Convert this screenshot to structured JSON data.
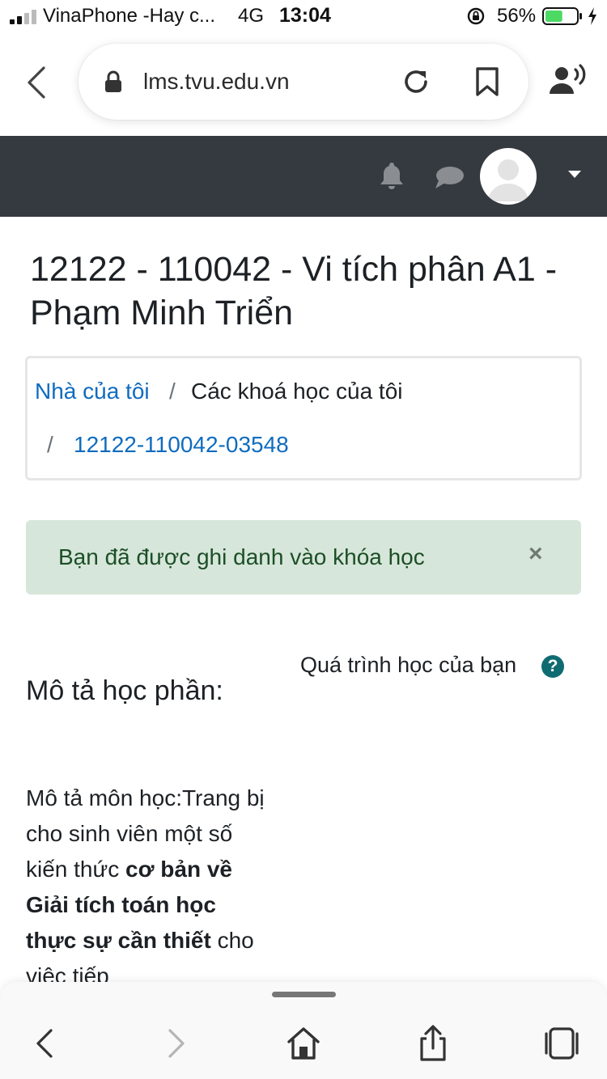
{
  "status_bar": {
    "carrier": "VinaPhone -Hay c...",
    "network": "4G",
    "time": "13:04",
    "battery_percent": "56%",
    "battery_level": 0.56
  },
  "browser": {
    "url": "lms.tvu.edu.vn"
  },
  "page": {
    "title": "12122 - 110042 - Vi tích phân A1 - Phạm Minh Triển"
  },
  "breadcrumb": {
    "home": "Nhà của tôi",
    "separator": "/",
    "courses": "Các khoá học của tôi",
    "course": "12122-110042-03548"
  },
  "alert": {
    "message": "Bạn đã được ghi danh vào khóa học",
    "close": "×"
  },
  "progress": {
    "label": "Quá trình học của bạn",
    "help": "?"
  },
  "description": {
    "heading": "Mô tả học phần:",
    "text_1": "Mô tả môn học:Trang bị cho sinh viên một số kiến thức ",
    "bold_1": "cơ bản về Giải tích toán học thực sự cần thiết",
    "text_2": " cho việc tiếp"
  },
  "colors": {
    "navbar": "#343a40",
    "link": "#0f6cbf",
    "alert_bg": "#d7e6da",
    "alert_text": "#1c4f27",
    "help_icon": "#0f6b72"
  }
}
